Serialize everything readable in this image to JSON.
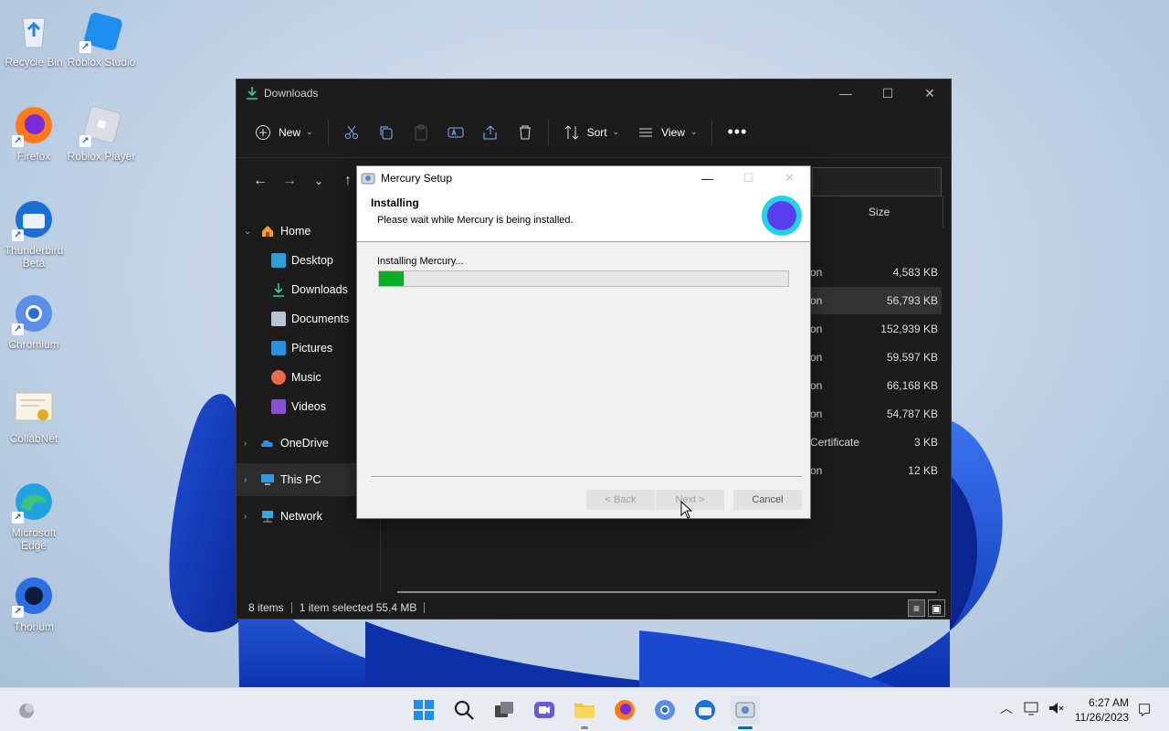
{
  "desktop": {
    "icons": [
      {
        "label": "Recycle Bin"
      },
      {
        "label": "Roblox Studio"
      },
      {
        "label": "Firefox"
      },
      {
        "label": "Roblox Player"
      },
      {
        "label": "Thunderbird Beta"
      },
      {
        "label": "Chromium"
      },
      {
        "label": "CollabNet"
      },
      {
        "label": "Microsoft Edge"
      },
      {
        "label": "Thorium"
      }
    ]
  },
  "explorer": {
    "title": "Downloads",
    "toolbar": {
      "new_label": "New",
      "sort_label": "Sort",
      "view_label": "View"
    },
    "sidebar": {
      "home": "Home",
      "desktop": "Desktop",
      "downloads": "Downloads",
      "documents": "Documents",
      "pictures": "Pictures",
      "music": "Music",
      "videos": "Videos",
      "onedrive": "OneDrive",
      "thispc": "This PC",
      "network": "Network"
    },
    "column_size": "Size",
    "rows": [
      {
        "type": "on",
        "size": "4,583 KB"
      },
      {
        "type": "on",
        "size": "56,793 KB"
      },
      {
        "type": "on",
        "size": "152,939 KB"
      },
      {
        "type": "on",
        "size": "59,597 KB"
      },
      {
        "type": "on",
        "size": "66,168 KB"
      },
      {
        "type": "on",
        "size": "54,787 KB"
      },
      {
        "type": "Certificate",
        "size": "3 KB"
      },
      {
        "type": "on",
        "size": "12 KB"
      }
    ],
    "status": {
      "items": "8 items",
      "selected": "1 item selected  55.4 MB"
    }
  },
  "setup": {
    "title": "Mercury Setup",
    "heading": "Installing",
    "subheading": "Please wait while Mercury is being installed.",
    "progress_label": "Installing Mercury...",
    "progress_fraction": 0.06,
    "back_label": "< Back",
    "next_label": "Next >",
    "cancel_label": "Cancel"
  },
  "taskbar": {
    "time": "6:27 AM",
    "date": "11/26/2023"
  }
}
